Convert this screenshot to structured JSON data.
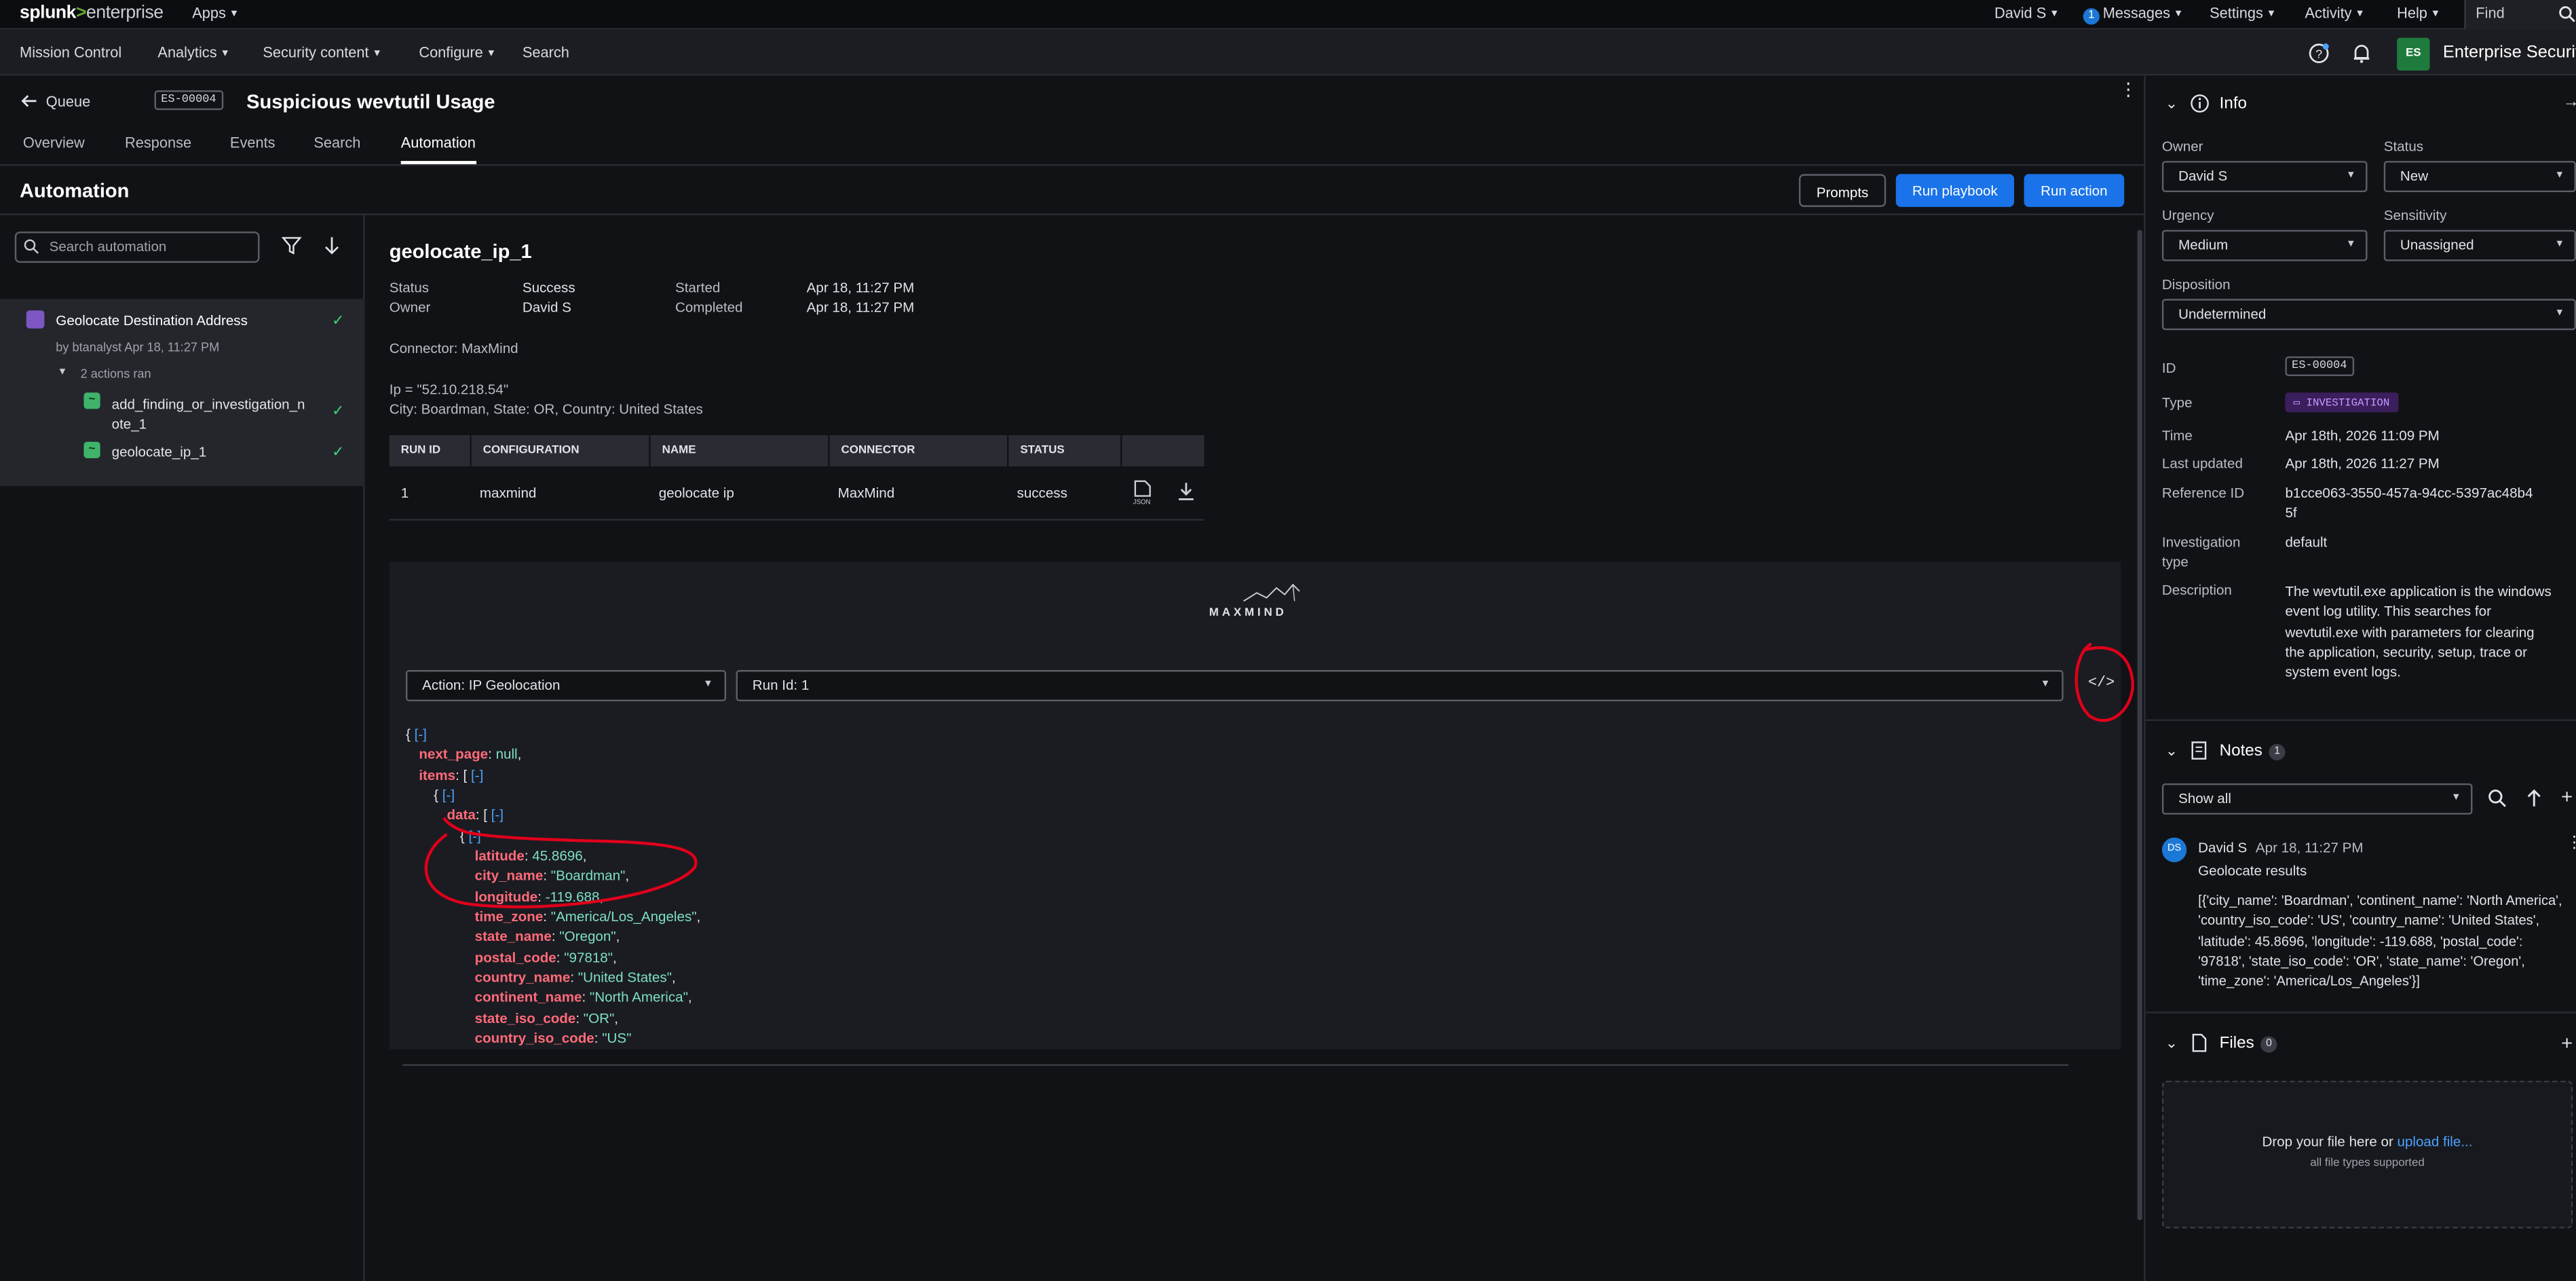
{
  "topbar": {
    "logo_a": "splunk",
    "logo_gt": ">",
    "logo_b": "enterprise",
    "apps": "Apps",
    "user": "David S",
    "messages_count": "1",
    "messages": "Messages",
    "settings": "Settings",
    "activity": "Activity",
    "help": "Help",
    "find": "Find"
  },
  "navbar": {
    "items": [
      "Mission Control",
      "Analytics",
      "Security content",
      "Configure",
      "Search"
    ],
    "app_initials": "ES",
    "app_name": "Enterprise Security"
  },
  "header": {
    "back": "Queue",
    "id": "ES-00004",
    "title": "Suspicious wevtutil Usage",
    "tabs": [
      "Overview",
      "Response",
      "Events",
      "Search",
      "Automation"
    ],
    "active_tab": "Automation"
  },
  "automation": {
    "heading": "Automation",
    "buttons": {
      "prompts": "Prompts",
      "run_playbook": "Run playbook",
      "run_action": "Run action"
    },
    "search_placeholder": "Search automation",
    "playbook": {
      "name": "Geolocate Destination Address",
      "by": "by btanalyst  Apr 18, 11:27 PM",
      "actions_ran": "2 actions ran",
      "actions": [
        {
          "name_line1": "add_finding_or_investigation_n",
          "name_line2": "ote_1"
        },
        {
          "name_line1": "geolocate_ip_1",
          "name_line2": ""
        }
      ]
    }
  },
  "detail": {
    "title": "geolocate_ip_1",
    "status_label": "Status",
    "status": "Success",
    "owner_label": "Owner",
    "owner": "David S",
    "started_label": "Started",
    "started": "Apr 18, 11:27 PM",
    "completed_label": "Completed",
    "completed": "Apr 18, 11:27 PM",
    "connector": "Connector: MaxMind",
    "ip": "Ip = \"52.10.218.54\"",
    "summary": "City: Boardman, State: OR, Country: United States",
    "table": {
      "headers": [
        "RUN ID",
        "CONFIGURATION",
        "NAME",
        "CONNECTOR",
        "STATUS"
      ],
      "rows": [
        [
          "1",
          "maxmind",
          "geolocate ip",
          "MaxMind",
          "success"
        ]
      ]
    },
    "widget": {
      "brand": "MAXMIND",
      "action_select": "Action: IP Geolocation",
      "run_select": "Run Id: 1"
    },
    "json": {
      "open": "{",
      "collapse": "[-]",
      "next_page_key": "next_page",
      "next_page_val": "null",
      "items_key": "items",
      "data_key": "data",
      "fields": [
        {
          "key": "latitude",
          "value": "45.8696"
        },
        {
          "key": "city_name",
          "value": "\"Boardman\""
        },
        {
          "key": "longitude",
          "value": "-119.688"
        },
        {
          "key": "time_zone",
          "value": "\"America/Los_Angeles\""
        },
        {
          "key": "state_name",
          "value": "\"Oregon\""
        },
        {
          "key": "postal_code",
          "value": "\"97818\""
        },
        {
          "key": "country_name",
          "value": "\"United States\""
        },
        {
          "key": "continent_name",
          "value": "\"North America\""
        },
        {
          "key": "state_iso_code",
          "value": "\"OR\""
        },
        {
          "key": "country_iso_code",
          "value": "\"US\""
        }
      ]
    }
  },
  "info": {
    "title": "Info",
    "owner_label": "Owner",
    "owner": "David S",
    "status_label": "Status",
    "status": "New",
    "urgency_label": "Urgency",
    "urgency": "Medium",
    "sensitivity_label": "Sensitivity",
    "sensitivity": "Unassigned",
    "disposition_label": "Disposition",
    "disposition": "Undetermined",
    "id_label": "ID",
    "id": "ES-00004",
    "type_label": "Type",
    "type": "INVESTIGATION",
    "time_label": "Time",
    "time": "Apr 18th, 2026 11:09 PM",
    "last_updated_label": "Last updated",
    "last_updated": "Apr 18th, 2026 11:27 PM",
    "reference_label": "Reference ID",
    "reference_line1": "b1cce063-3550-457a-94cc-5397ac48b4",
    "reference_line2": "5f",
    "inv_type_label_1": "Investigation",
    "inv_type_label_2": "type",
    "inv_type": "default",
    "description_label": "Description",
    "description_lines": [
      "The wevtutil.exe application is the windows",
      "event log utility. This searches for",
      "wevtutil.exe with parameters for clearing",
      "the application, security, setup, trace or",
      "system event logs."
    ]
  },
  "notes": {
    "title": "Notes",
    "count": "1",
    "filter": "Show all",
    "note": {
      "initials": "DS",
      "author": "David S",
      "time": "Apr 18, 11:27 PM",
      "title": "Geolocate results",
      "body_lines": [
        "[{'city_name': 'Boardman', 'continent_name': 'North America',",
        "'country_iso_code': 'US', 'country_name': 'United States',",
        "'latitude': 45.8696, 'longitude': -119.688, 'postal_code':",
        "'97818', 'state_iso_code': 'OR', 'state_name': 'Oregon',",
        "'time_zone': 'America/Los_Angeles'}]"
      ]
    }
  },
  "files": {
    "title": "Files",
    "count": "0",
    "drop_text": "Drop your file here or ",
    "upload_link": "upload file...",
    "types": "all file types supported"
  },
  "colors": {
    "accent": "#1a73e8",
    "success": "#3fd27a",
    "json_key": "#ff6b7a",
    "json_value": "#7ee0c6",
    "annotation": "#e0001b"
  }
}
